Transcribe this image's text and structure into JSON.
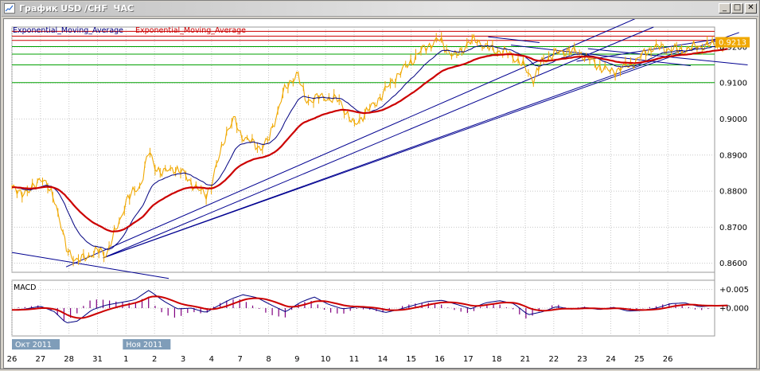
{
  "window": {
    "title": "График USD /CHF  ЧАС",
    "minimize_glyph": "_",
    "maximize_glyph": "□",
    "close_glyph": "✕"
  },
  "colors": {
    "price": "#f0a800",
    "ema_fast": "#000080",
    "ema_slow": "#cc0000",
    "trendline": "#000090",
    "level_green": "#00a000",
    "level_red": "#cc0000",
    "hist": "#800080",
    "price_tag": "#f0a800"
  },
  "chart_data": [
    {
      "type": "line",
      "title": "",
      "legend": [
        "Exponential_Moving_Average",
        "Exponential_Moving_Average"
      ],
      "current_price_label": "0.9213",
      "x_ticks": [
        "26",
        "27",
        "28",
        "31",
        "1",
        "2",
        "3",
        "4",
        "7",
        "8",
        "9",
        "10",
        "11",
        "14",
        "15",
        "16",
        "17",
        "18",
        "21",
        "22",
        "23",
        "24",
        "25",
        "26"
      ],
      "month_labels": [
        "Окт 2011",
        "Ноя 2011"
      ],
      "y_ticks": [
        "0.9200",
        "0.9100",
        "0.9000",
        "0.8900",
        "0.8800",
        "0.8700",
        "0.8600"
      ],
      "ylim": [
        0.8575,
        0.9255
      ],
      "horizontal_levels_green": [
        0.9101,
        0.915,
        0.918,
        0.9201
      ],
      "horizontal_levels_red": [
        0.9243,
        0.923,
        0.9218
      ],
      "close_series": {
        "name": "",
        "x_days": [
          0,
          0.6,
          1,
          1.5,
          1.9,
          2.3,
          3,
          3.3,
          3.8,
          4,
          4.5,
          4.8,
          5,
          5.3,
          5.7,
          6,
          6.5,
          6.8,
          7,
          7.5,
          7.8,
          8,
          8.3,
          8.7,
          9,
          9.5,
          10,
          10.3,
          10.7,
          11,
          11.5,
          12,
          12.3,
          12.7,
          13,
          13.5,
          14,
          14.5,
          15,
          15.5,
          16,
          16.3,
          16.6,
          17,
          17.5,
          18,
          18.3,
          18.6,
          19,
          19.5,
          20,
          20.5,
          21,
          21.3,
          21.7,
          22,
          22.5,
          23,
          23.5,
          24,
          24.5,
          25.1
        ],
        "values": [
          0.8805,
          0.8795,
          0.884,
          0.878,
          0.864,
          0.8605,
          0.8635,
          0.8625,
          0.872,
          0.8775,
          0.8815,
          0.891,
          0.887,
          0.885,
          0.8865,
          0.885,
          0.8805,
          0.879,
          0.882,
          0.896,
          0.9,
          0.896,
          0.894,
          0.892,
          0.894,
          0.907,
          0.913,
          0.905,
          0.906,
          0.906,
          0.905,
          0.898,
          0.901,
          0.904,
          0.907,
          0.912,
          0.916,
          0.92,
          0.922,
          0.917,
          0.921,
          0.922,
          0.92,
          0.919,
          0.918,
          0.914,
          0.911,
          0.916,
          0.918,
          0.919,
          0.918,
          0.915,
          0.913,
          0.914,
          0.915,
          0.917,
          0.92,
          0.9195,
          0.919,
          0.92,
          0.9205,
          0.9213
        ]
      }
    },
    {
      "type": "line",
      "title": "MACD",
      "y_ticks": [
        "+0.005",
        "+0.000"
      ],
      "ylim": [
        -0.0075,
        0.0075
      ],
      "macd_series": {
        "x_days": [
          0,
          0.5,
          1,
          1.5,
          1.9,
          2.3,
          2.8,
          3.3,
          3.8,
          4.3,
          4.8,
          5.3,
          5.8,
          6.3,
          6.8,
          7.2,
          7.7,
          8.1,
          8.6,
          9.1,
          9.6,
          10.1,
          10.6,
          11.1,
          11.6,
          12.1,
          12.6,
          13.1,
          13.6,
          14.1,
          14.6,
          15.1,
          15.6,
          16.1,
          16.6,
          17.1,
          17.6,
          18.1,
          18.6,
          19.1,
          19.6,
          20.1,
          20.6,
          21.1,
          21.6,
          22.1,
          22.6,
          23.1,
          23.6,
          24.1,
          24.6,
          25.1
        ],
        "values": [
          -0.0005,
          -0.0002,
          0.0005,
          -0.001,
          -0.004,
          -0.0035,
          -0.0005,
          0.0008,
          0.0015,
          0.0022,
          0.0048,
          0.002,
          -0.0002,
          0.0,
          -0.0012,
          0.0005,
          0.0025,
          0.0036,
          0.0028,
          0.0008,
          -0.001,
          0.0015,
          0.003,
          0.001,
          -0.0002,
          0.0003,
          -0.0001,
          -0.0012,
          -0.0003,
          0.0008,
          0.0018,
          0.0021,
          0.001,
          -0.0002,
          0.0014,
          0.002,
          0.0012,
          -0.0018,
          -0.001,
          0.0004,
          -0.0003,
          0.0002,
          -0.0004,
          0.0002,
          -0.0008,
          -0.0006,
          0.0,
          0.0012,
          0.0014,
          0.0004,
          0.0006,
          0.0008
        ]
      }
    }
  ]
}
